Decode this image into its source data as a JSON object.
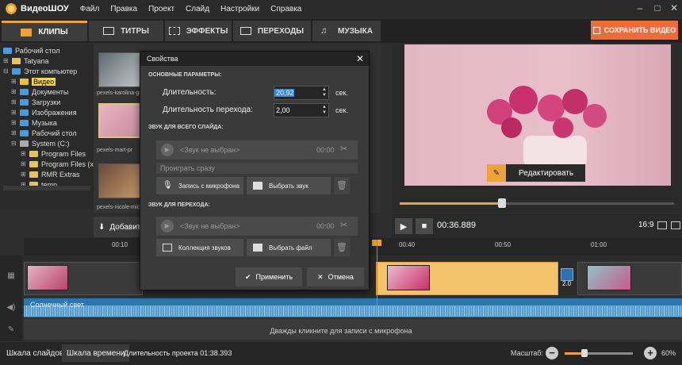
{
  "app": {
    "name": "ВидеоШОУ"
  },
  "menu": [
    "Файл",
    "Правка",
    "Проект",
    "Слайд",
    "Настройки",
    "Справка"
  ],
  "window_controls": [
    "–",
    "□",
    "✕"
  ],
  "tabs": [
    {
      "label": "КЛИПЫ"
    },
    {
      "label": "ТИТРЫ"
    },
    {
      "label": "ЭФФЕКТЫ"
    },
    {
      "label": "ПЕРЕХОДЫ"
    },
    {
      "label": "МУЗЫКА"
    }
  ],
  "save_button": "СОХРАНИТЬ ВИДЕО",
  "tree": [
    {
      "label": "Рабочий стол"
    },
    {
      "label": "Tatyana"
    },
    {
      "label": "Этот компьютер"
    },
    {
      "label": "Видео"
    },
    {
      "label": "Документы"
    },
    {
      "label": "Загрузки"
    },
    {
      "label": "Изображения"
    },
    {
      "label": "Музыка"
    },
    {
      "label": "Рабочий стол"
    },
    {
      "label": "System (C:)"
    },
    {
      "label": "Program Files"
    },
    {
      "label": "Program Files (x"
    },
    {
      "label": "RMR Extras"
    },
    {
      "label": "temp"
    }
  ],
  "thumbs": [
    {
      "caption": "pexels-karolina-gr"
    },
    {
      "caption": "pexels-mart-pr"
    },
    {
      "caption": "pexels-nicole-mich"
    }
  ],
  "add_button": "Добавит",
  "preview": {
    "edit_button": "Редактировать",
    "time": "00:36.889",
    "ratio": "16:9",
    "scrub_progress": 0.37
  },
  "ruler": [
    "00:10",
    "00:40",
    "00:50",
    "01:00"
  ],
  "timeline": {
    "transition_duration": "2.0",
    "audio_label": "Солнечный свет",
    "mic_hint": "Дважды кликните для записи с микрофона"
  },
  "statusbar": {
    "tab_slides": "Шкала слайдов",
    "tab_timeline": "Шкала времени",
    "duration": "Длительность проекта 01:38.393",
    "zoom_label": "Масштаб:",
    "zoom_value": "60%",
    "zoom_progress": 0.3
  },
  "dialog": {
    "title": "Свойства",
    "section_main": "ОСНОВНЫЕ ПАРАМЕТРЫ:",
    "duration_label": "Длительность:",
    "duration_value": "20,92",
    "transition_label": "Длительность перехода:",
    "transition_value": "2,00",
    "unit": "сек.",
    "section_slide_sound": "ЗВУК ДЛЯ ВСЕГО СЛАЙДА:",
    "sound_placeholder": "<Звук не выбран>",
    "sound_time": "00:00",
    "play_now": "Проиграть сразу",
    "record_button": "Запись с микрофона",
    "choose_sound_button": "Выбрать звук",
    "section_transition_sound": "ЗВУК ДЛЯ ПЕРЕХОДА:",
    "collection_button": "Коллекция звуков",
    "choose_file_button": "Выбрать файл",
    "apply_button": "Применить",
    "cancel_button": "Отмена"
  },
  "colors": {
    "accent": "#f0a23a",
    "save": "#f06b3a",
    "audio": "#2d77b0"
  }
}
